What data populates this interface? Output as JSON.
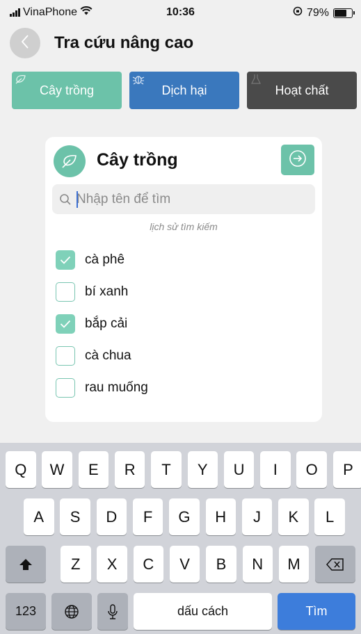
{
  "status": {
    "carrier": "VinaPhone",
    "time": "10:36",
    "battery": "79%",
    "battery_level": 0.79
  },
  "header": {
    "title": "Tra cứu nâng cao"
  },
  "tabs": [
    {
      "label": "Cây trồng",
      "color": "#6cc2a9"
    },
    {
      "label": "Dịch hại",
      "color": "#3a78bd"
    },
    {
      "label": "Hoạt chất",
      "color": "#4a4a4a"
    }
  ],
  "card": {
    "title": "Cây trồng",
    "search_placeholder": "Nhập tên để tìm",
    "history_label": "lịch sử tìm kiếm",
    "history": [
      {
        "label": "cà phê",
        "checked": true
      },
      {
        "label": "bí xanh",
        "checked": false
      },
      {
        "label": "bắp cải",
        "checked": true
      },
      {
        "label": "cà chua",
        "checked": false
      },
      {
        "label": "rau muống",
        "checked": false
      }
    ]
  },
  "keyboard": {
    "row1": [
      "Q",
      "W",
      "E",
      "R",
      "T",
      "Y",
      "U",
      "I",
      "O",
      "P"
    ],
    "row2": [
      "A",
      "S",
      "D",
      "F",
      "G",
      "H",
      "J",
      "K",
      "L"
    ],
    "row3": [
      "Z",
      "X",
      "C",
      "V",
      "B",
      "N",
      "M"
    ],
    "numbers_label": "123",
    "space_label": "dấu cách",
    "return_label": "Tìm"
  },
  "colors": {
    "accent": "#6cc2a9",
    "pest": "#3a78bd",
    "chem": "#4a4a4a",
    "return_key": "#3d7ddb"
  }
}
